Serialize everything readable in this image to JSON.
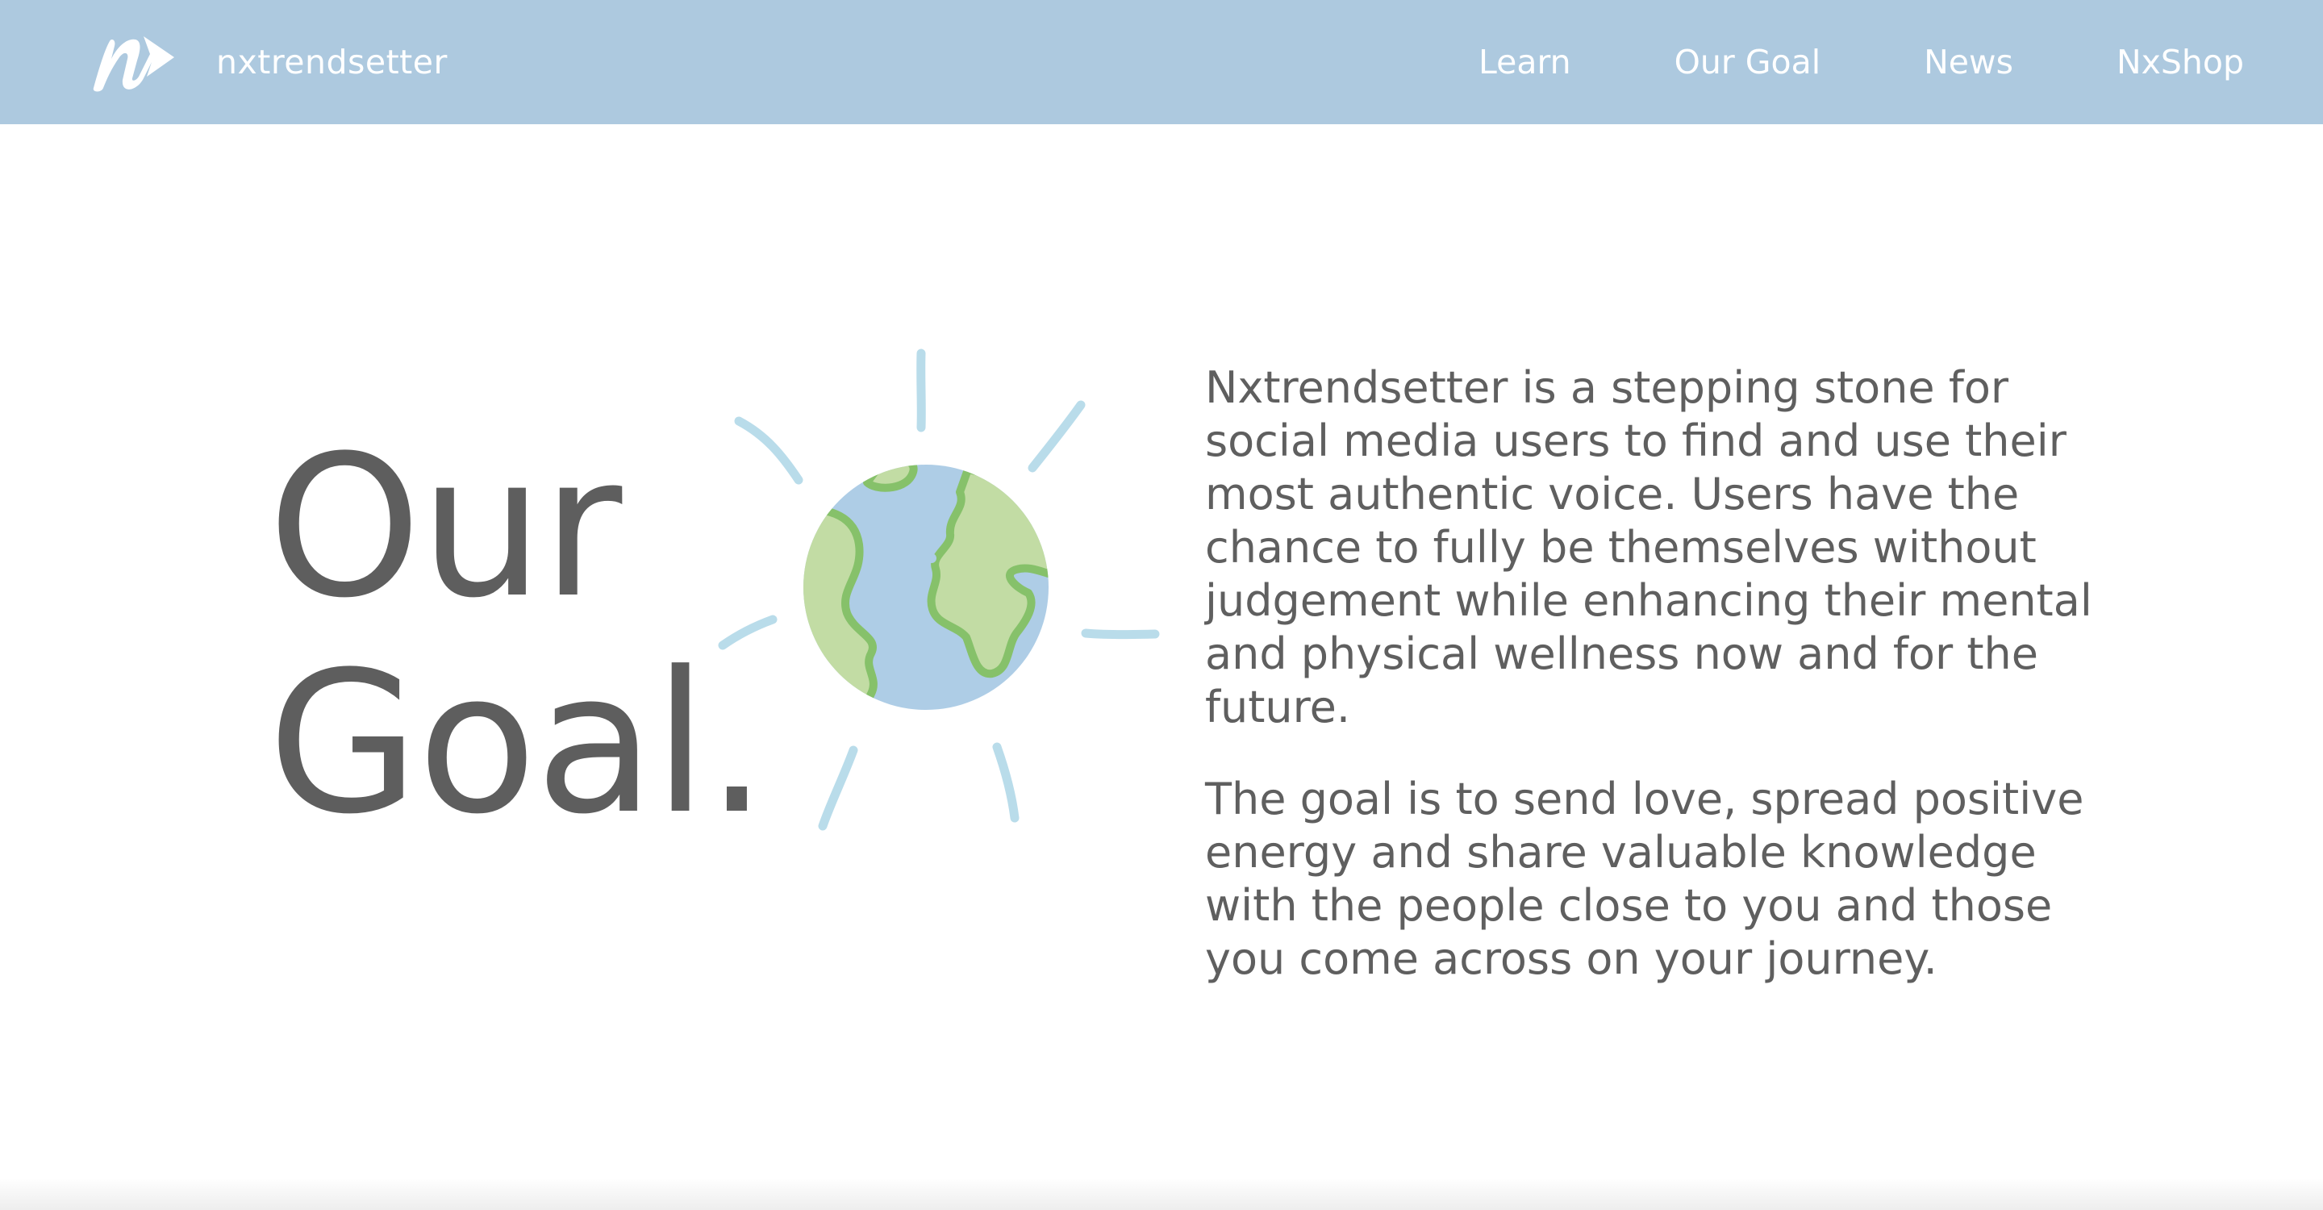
{
  "brand": {
    "logo_icon": "nx-arrow-logo-icon",
    "name": "nxtrendsetter"
  },
  "nav": {
    "items": [
      {
        "label": "Learn"
      },
      {
        "label": "Our Goal"
      },
      {
        "label": "News"
      },
      {
        "label": "NxShop"
      }
    ]
  },
  "colors": {
    "navbar": "#adc9df",
    "text": "#5e5e5e",
    "globe_ocean": "#aecde6",
    "globe_land": "#c2dca4",
    "globe_land_edge": "#86c16a",
    "sun_rays": "#b9dcea"
  },
  "hero": {
    "heading_line1": "Our",
    "heading_line2": "Goal.",
    "illustration_icon": "earth-globe-icon",
    "paragraph1": "Nxtrendsetter is a stepping stone for social media users to find and use their most authentic voice. Users have the chance to fully be themselves without judgement while enhancing their mental and physical wellness now and for the future.",
    "paragraph2": "The goal is to send love, spread positive energy and share valuable knowledge with the people close to you and those you come across on your journey."
  }
}
